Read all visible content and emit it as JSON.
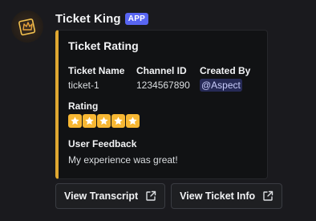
{
  "message": {
    "author": "Ticket King",
    "badge": "APP"
  },
  "embed": {
    "accent_color": "#e0a831",
    "title": "Ticket Rating",
    "fields": [
      {
        "name": "Ticket Name",
        "value": "ticket-1"
      },
      {
        "name": "Channel ID",
        "value": "1234567890"
      },
      {
        "name": "Created By",
        "value": "@Aspect"
      }
    ],
    "rating": {
      "name": "Rating",
      "stars": 5,
      "max_stars": 5
    },
    "feedback": {
      "name": "User Feedback",
      "value": "My experience was great!"
    }
  },
  "buttons": [
    {
      "label": "View Transcript",
      "icon": "external-link-icon"
    },
    {
      "label": "View Ticket Info",
      "icon": "external-link-icon"
    }
  ],
  "colors": {
    "background": "#1a1a1e",
    "embed_background": "#111214",
    "badge": "#5865f2",
    "star": "#f7b733"
  }
}
